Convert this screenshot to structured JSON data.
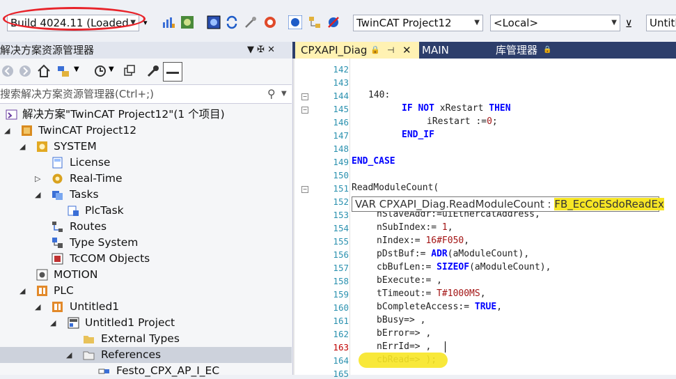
{
  "toolbar": {
    "build_combo": "Build 4024.11 (Loaded",
    "project_combo": "TwinCAT Project12",
    "target_combo": "<Local>",
    "right_combo": "Untitl"
  },
  "solution_explorer": {
    "title": "解决方案资源管理器",
    "pin": "▼ ✠ ✕",
    "search_placeholder": "搜索解决方案资源管理器(Ctrl+;)",
    "items": [
      {
        "label": "解决方案\"TwinCAT Project12\"(1 个项目)"
      },
      {
        "label": "TwinCAT Project12"
      },
      {
        "label": "SYSTEM"
      },
      {
        "label": "License"
      },
      {
        "label": "Real-Time"
      },
      {
        "label": "Tasks"
      },
      {
        "label": "PlcTask"
      },
      {
        "label": "Routes"
      },
      {
        "label": "Type System"
      },
      {
        "label": "TcCOM Objects"
      },
      {
        "label": "MOTION"
      },
      {
        "label": "PLC"
      },
      {
        "label": "Untitled1"
      },
      {
        "label": "Untitled1 Project"
      },
      {
        "label": "External Types"
      },
      {
        "label": "References"
      },
      {
        "label": "Festo_CPX_AP_I_EC"
      }
    ]
  },
  "tabs": [
    {
      "label": "CPXAPI_Diag"
    },
    {
      "label": "MAIN"
    },
    {
      "label": "库管理器"
    }
  ],
  "editor": {
    "lines": [
      {
        "n": "142",
        "t": ""
      },
      {
        "n": "143",
        "t": ""
      },
      {
        "n": "144",
        "t": "140:"
      },
      {
        "n": "145",
        "t": "IF NOT xRestart THEN"
      },
      {
        "n": "146",
        "t": "iRestart :=0;"
      },
      {
        "n": "147",
        "t": "END_IF"
      },
      {
        "n": "148",
        "t": ""
      },
      {
        "n": "149",
        "t": "END_CASE"
      },
      {
        "n": "150",
        "t": ""
      },
      {
        "n": "151",
        "t": "ReadModuleCount("
      },
      {
        "n": "152",
        "t": ""
      },
      {
        "n": "153",
        "t": "nSlaveAddr:=uiEthercatAddress,"
      },
      {
        "n": "154",
        "t": "nSubIndex:= 1,"
      },
      {
        "n": "155",
        "t": "nIndex:= 16#F050,"
      },
      {
        "n": "156",
        "t": "pDstBuf:= ADR(aModuleCount),"
      },
      {
        "n": "157",
        "t": "cbBufLen:= SIZEOF(aModuleCount),"
      },
      {
        "n": "158",
        "t": "bExecute:= ,"
      },
      {
        "n": "159",
        "t": "tTimeout:= T#1000MS,"
      },
      {
        "n": "160",
        "t": "bCompleteAccess:= TRUE,"
      },
      {
        "n": "161",
        "t": "bBusy=> ,"
      },
      {
        "n": "162",
        "t": "bError=> ,"
      },
      {
        "n": "163",
        "t": "nErrId=> ,"
      },
      {
        "n": "164",
        "t": "cbRead=> );"
      },
      {
        "n": "165",
        "t": ""
      }
    ],
    "tooltip_prefix": "VAR CPXAPI_Diag.ReadModuleCount : ",
    "tooltip_type": "FB_EcCoESdoReadEx"
  }
}
